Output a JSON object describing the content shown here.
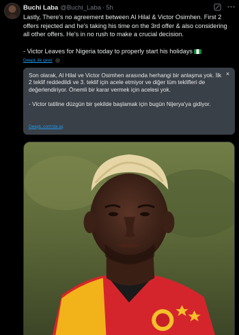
{
  "author": {
    "name": "Buchi Laba",
    "handle": "@Buchi_Laba",
    "separator": "·",
    "time": "5h"
  },
  "tweet": {
    "paragraph1": "Lastly, There's no agreement between Al Hilal & Victor Osimhen. First 2 offers rejected and he's taking his time on the 3rd offer & also considering all other offers. He's in no rush to make a crucial decision.",
    "paragraph2": "- Victor Leaves for Nigeria today to properly start his holidays",
    "flag_icon": "nigeria-flag"
  },
  "translate": {
    "link_text": "DeepL ile çevir",
    "icon": "settings-icon"
  },
  "translation": {
    "paragraph1": "Son olarak, Al Hilal ve Victor Osimhen arasında herhangi bir anlaşma yok. İlk 2 teklif reddedildi ve 3. teklif için acele etmiyor ve diğer tüm teklifleri de değerlendiriyor. Önemli bir karar vermek için acelesi yok.",
    "paragraph2": "- Victor tatiline düzgün bir şekilde başlamak için bugün Nijerya'ya gidiyor.",
    "source_link": "DeepL.com'da aç",
    "close_symbol": "×"
  },
  "colors": {
    "background": "#000000",
    "text": "#e7e9ea",
    "muted": "#71767b",
    "link": "#1d9bf0",
    "translation_bg": "#3a4048"
  }
}
